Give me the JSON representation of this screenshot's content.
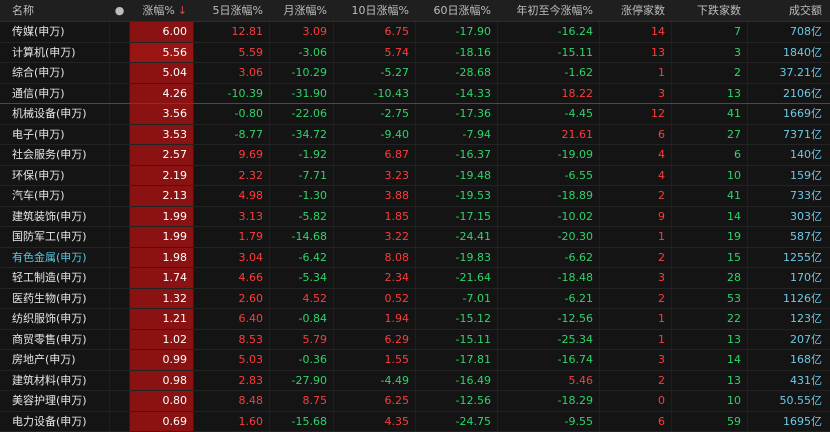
{
  "headers": {
    "name": "名称",
    "dot": "●",
    "zf": "涨幅%",
    "sort": "↓",
    "d5": "5日涨幅%",
    "mon": "月涨幅%",
    "d10": "10日涨幅%",
    "d60": "60日涨幅%",
    "ytd": "年初至今涨幅%",
    "up": "涨停家数",
    "dn": "下跌家数",
    "amt": "成交额"
  },
  "colors": {
    "rise": "#ff3b3b",
    "fall": "#2fd36a",
    "amount": "#6ec8e6",
    "highlight_name": "#5ac8e6",
    "change_cell_bg": "#8a1212"
  },
  "rows": [
    {
      "name": "传媒(申万)",
      "zf": "6.00",
      "d5": "12.81",
      "mon": "3.09",
      "d10": "6.75",
      "d60": "-17.90",
      "ytd": "-16.24",
      "up": "14",
      "dn": "7",
      "amt": "708亿"
    },
    {
      "name": "计算机(申万)",
      "zf": "5.56",
      "d5": "5.59",
      "mon": "-3.06",
      "d10": "5.74",
      "d60": "-18.16",
      "ytd": "-15.11",
      "up": "13",
      "dn": "3",
      "amt": "1840亿"
    },
    {
      "name": "综合(申万)",
      "zf": "5.04",
      "d5": "3.06",
      "mon": "-10.29",
      "d10": "-5.27",
      "d60": "-28.68",
      "ytd": "-1.62",
      "up": "1",
      "dn": "2",
      "amt": "37.21亿"
    },
    {
      "name": "通信(申万)",
      "zf": "4.26",
      "d5": "-10.39",
      "mon": "-31.90",
      "d10": "-10.43",
      "d60": "-14.33",
      "ytd": "18.22",
      "up": "3",
      "dn": "13",
      "amt": "2106亿"
    },
    {
      "name": "机械设备(申万)",
      "zf": "3.56",
      "d5": "-0.80",
      "mon": "-22.06",
      "d10": "-2.75",
      "d60": "-17.36",
      "ytd": "-4.45",
      "up": "12",
      "dn": "41",
      "amt": "1669亿"
    },
    {
      "name": "电子(申万)",
      "zf": "3.53",
      "d5": "-8.77",
      "mon": "-34.72",
      "d10": "-9.40",
      "d60": "-7.94",
      "ytd": "21.61",
      "up": "6",
      "dn": "27",
      "amt": "7371亿"
    },
    {
      "name": "社会服务(申万)",
      "zf": "2.57",
      "d5": "9.69",
      "mon": "-1.92",
      "d10": "6.87",
      "d60": "-16.37",
      "ytd": "-19.09",
      "up": "4",
      "dn": "6",
      "amt": "140亿"
    },
    {
      "name": "环保(申万)",
      "zf": "2.19",
      "d5": "2.32",
      "mon": "-7.71",
      "d10": "3.23",
      "d60": "-19.48",
      "ytd": "-6.55",
      "up": "4",
      "dn": "10",
      "amt": "159亿"
    },
    {
      "name": "汽车(申万)",
      "zf": "2.13",
      "d5": "4.98",
      "mon": "-1.30",
      "d10": "3.88",
      "d60": "-19.53",
      "ytd": "-18.89",
      "up": "2",
      "dn": "41",
      "amt": "733亿"
    },
    {
      "name": "建筑装饰(申万)",
      "zf": "1.99",
      "d5": "3.13",
      "mon": "-5.82",
      "d10": "1.85",
      "d60": "-17.15",
      "ytd": "-10.02",
      "up": "9",
      "dn": "14",
      "amt": "303亿"
    },
    {
      "name": "国防军工(申万)",
      "zf": "1.99",
      "d5": "1.79",
      "mon": "-14.68",
      "d10": "3.22",
      "d60": "-24.41",
      "ytd": "-20.30",
      "up": "1",
      "dn": "19",
      "amt": "587亿"
    },
    {
      "name": "有色金属(申万)",
      "zf": "1.98",
      "d5": "3.04",
      "mon": "-6.42",
      "d10": "8.08",
      "d60": "-19.83",
      "ytd": "-6.62",
      "up": "2",
      "dn": "15",
      "amt": "1255亿",
      "hl": true
    },
    {
      "name": "轻工制造(申万)",
      "zf": "1.74",
      "d5": "4.66",
      "mon": "-5.34",
      "d10": "2.34",
      "d60": "-21.64",
      "ytd": "-18.48",
      "up": "3",
      "dn": "28",
      "amt": "170亿"
    },
    {
      "name": "医药生物(申万)",
      "zf": "1.32",
      "d5": "2.60",
      "mon": "4.52",
      "d10": "0.52",
      "d60": "-7.01",
      "ytd": "-6.21",
      "up": "2",
      "dn": "53",
      "amt": "1126亿"
    },
    {
      "name": "纺织服饰(申万)",
      "zf": "1.21",
      "d5": "6.40",
      "mon": "-0.84",
      "d10": "1.94",
      "d60": "-15.12",
      "ytd": "-12.56",
      "up": "1",
      "dn": "22",
      "amt": "123亿"
    },
    {
      "name": "商贸零售(申万)",
      "zf": "1.02",
      "d5": "8.53",
      "mon": "5.79",
      "d10": "6.29",
      "d60": "-15.11",
      "ytd": "-25.34",
      "up": "1",
      "dn": "13",
      "amt": "207亿"
    },
    {
      "name": "房地产(申万)",
      "zf": "0.99",
      "d5": "5.03",
      "mon": "-0.36",
      "d10": "1.55",
      "d60": "-17.81",
      "ytd": "-16.74",
      "up": "3",
      "dn": "14",
      "amt": "168亿"
    },
    {
      "name": "建筑材料(申万)",
      "zf": "0.98",
      "d5": "2.83",
      "mon": "-27.90",
      "d10": "-4.49",
      "d60": "-16.49",
      "ytd": "5.46",
      "up": "2",
      "dn": "13",
      "amt": "431亿"
    },
    {
      "name": "美容护理(申万)",
      "zf": "0.80",
      "d5": "8.48",
      "mon": "8.75",
      "d10": "6.25",
      "d60": "-12.56",
      "ytd": "-18.29",
      "up": "0",
      "dn": "10",
      "amt": "50.55亿"
    },
    {
      "name": "电力设备(申万)",
      "zf": "0.69",
      "d5": "1.60",
      "mon": "-15.68",
      "d10": "4.35",
      "d60": "-24.75",
      "ytd": "-9.55",
      "up": "6",
      "dn": "59",
      "amt": "1695亿"
    }
  ]
}
